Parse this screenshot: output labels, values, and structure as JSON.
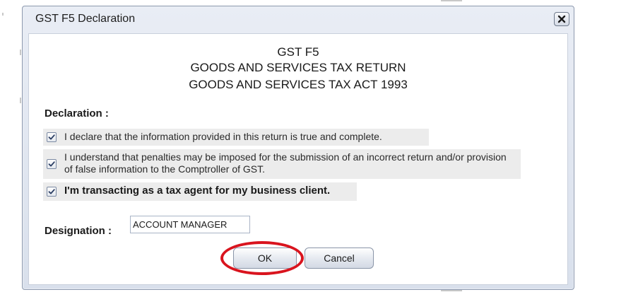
{
  "dialog": {
    "title": "GST F5 Declaration",
    "close_icon": "close-icon"
  },
  "form": {
    "heading_lines": [
      "GST F5",
      "GOODS AND SERVICES TAX RETURN",
      "GOODS AND SERVICES TAX ACT 1993"
    ],
    "declaration_label": "Declaration :",
    "declarations": [
      {
        "text": "I declare that the information provided in this return is true and complete.",
        "checked": true
      },
      {
        "text": "I understand that penalties may be imposed for the submission of an incorrect return and/or provision of false information to the Comptroller of GST.",
        "checked": true
      },
      {
        "text": "I'm transacting as a tax agent for my business client.",
        "checked": true
      }
    ],
    "designation_label": "Designation :",
    "designation_value": "ACCOUNT MANAGER"
  },
  "buttons": {
    "ok_label": "OK",
    "cancel_label": "Cancel"
  },
  "annotation": {
    "highlight_color": "#d9141e",
    "highlighted_target": "OK"
  },
  "icons": {
    "checkbox_check": "checkmark-icon"
  }
}
